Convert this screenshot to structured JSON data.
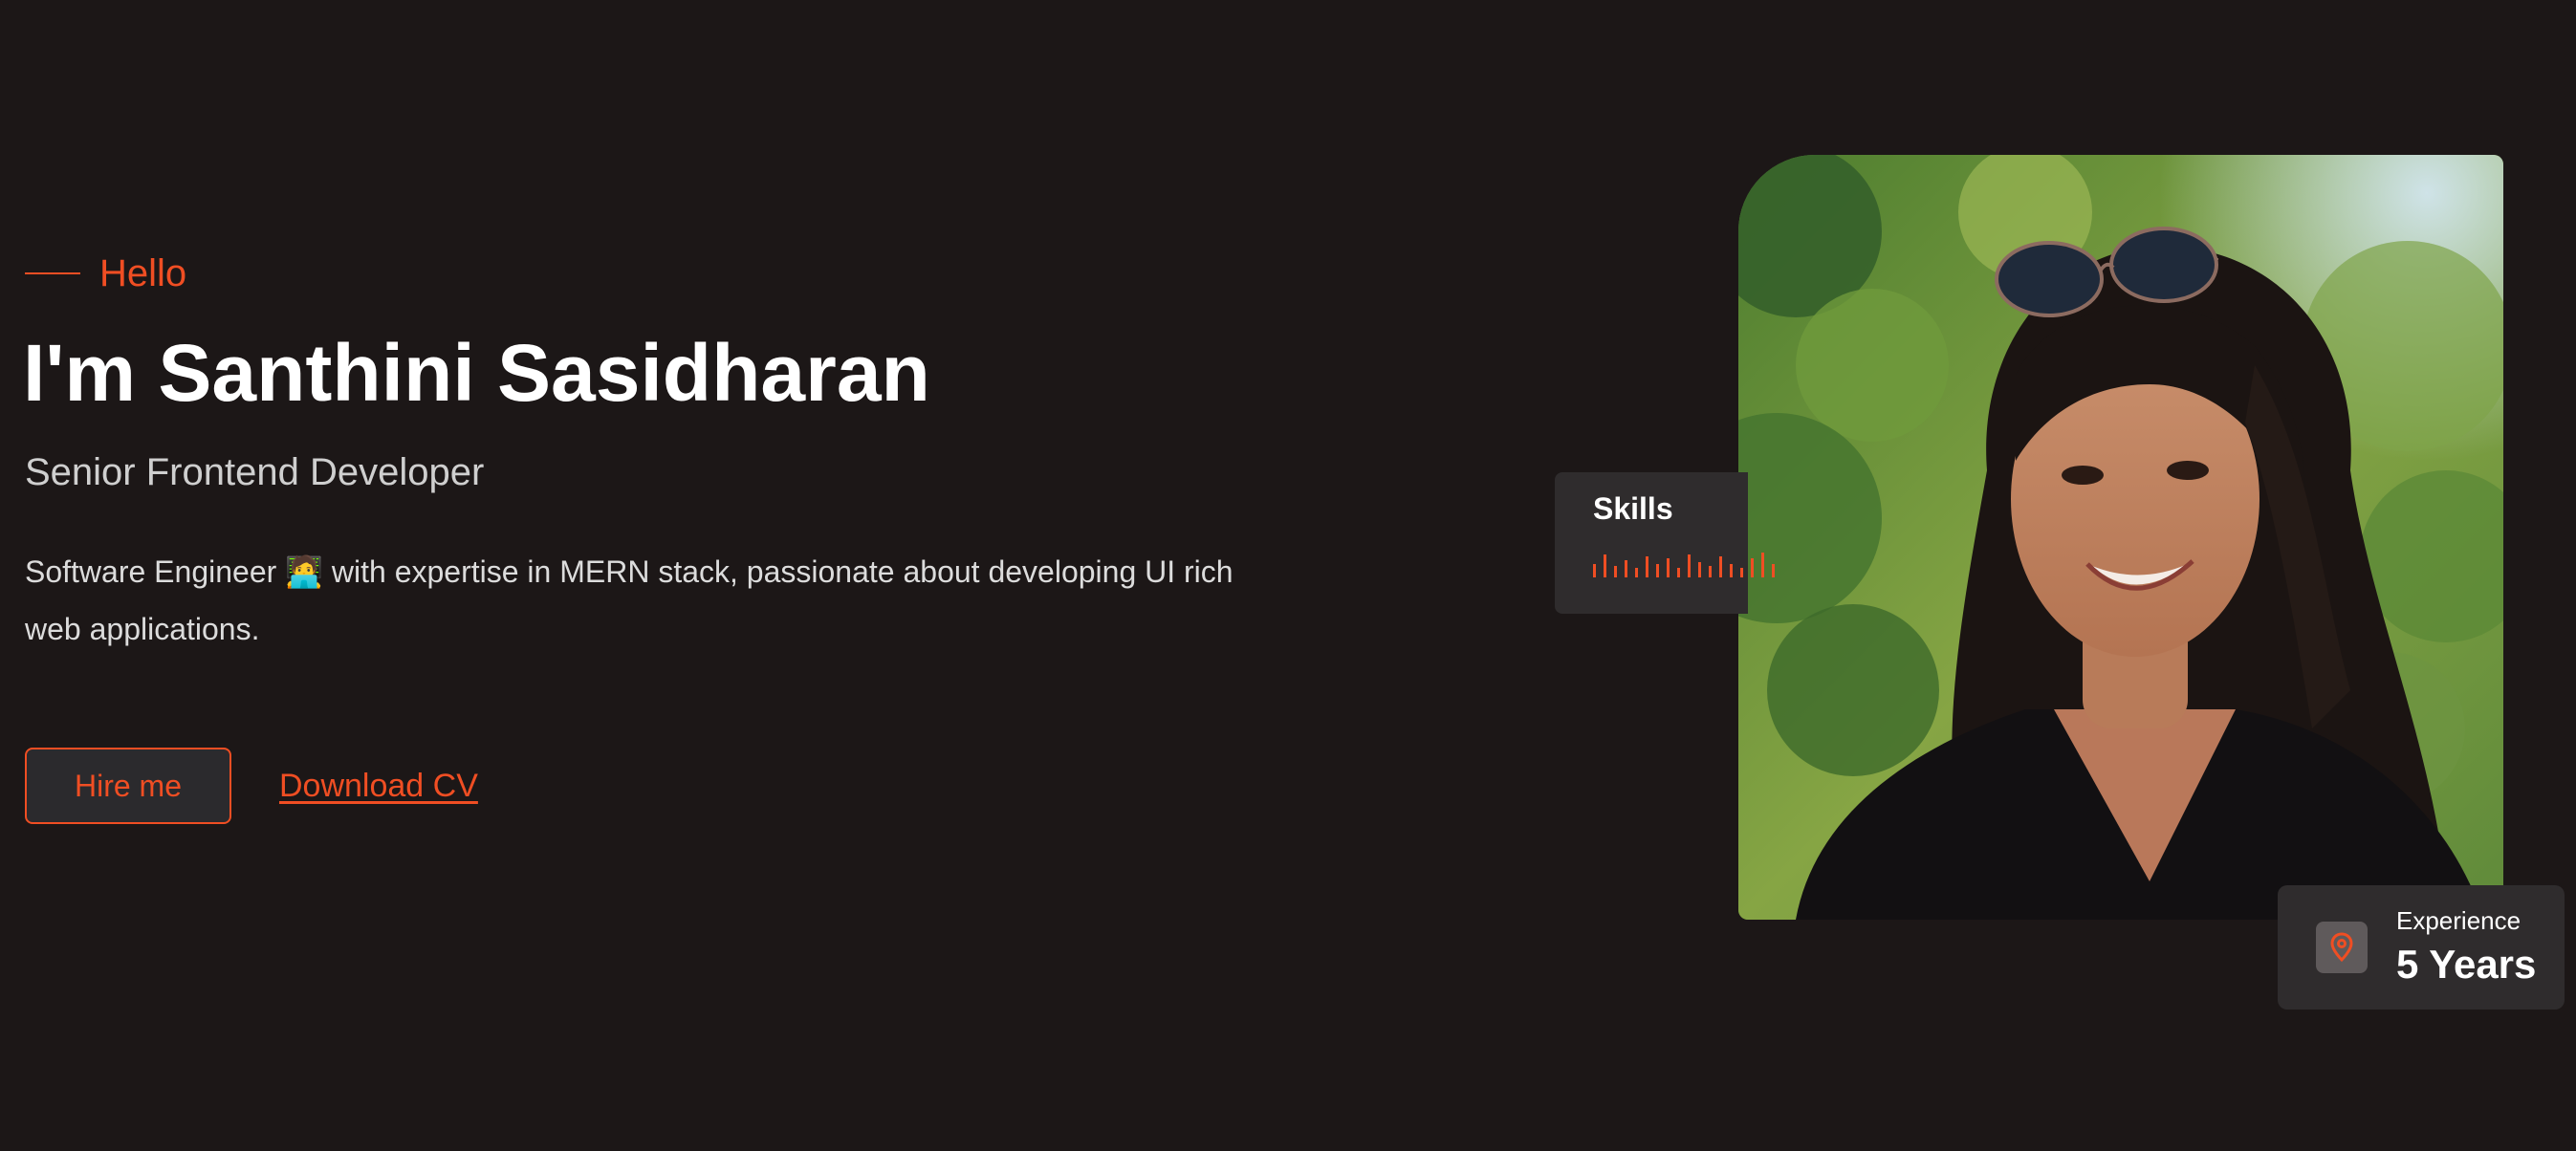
{
  "hero": {
    "greeting": "Hello",
    "headline": "I'm Santhini Sasidharan",
    "role": "Senior Frontend Developer",
    "bio": "Software Engineer 🧑‍💻 with expertise in MERN stack, passionate about developing UI rich web applications."
  },
  "actions": {
    "hire_label": "Hire me",
    "download_label": "Download CV"
  },
  "skills_card": {
    "title": "Skills"
  },
  "experience_card": {
    "label": "Experience",
    "value": "5 Years",
    "icon": "location-pin-icon"
  },
  "colors": {
    "background": "#1c1717",
    "accent": "#f04e23",
    "card": "#2f2c2d",
    "button_bg": "#2b2a2d",
    "text_primary": "#ffffff",
    "text_secondary": "#cfcfcf"
  }
}
